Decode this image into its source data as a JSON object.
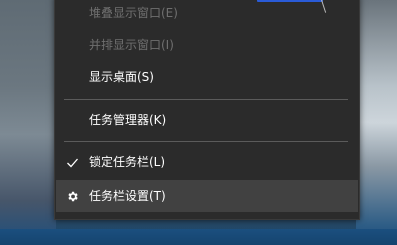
{
  "context_menu": {
    "items": [
      {
        "label": "堆叠显示窗口(E)",
        "enabled": false
      },
      {
        "label": "并排显示窗口(I)",
        "enabled": false
      },
      {
        "label": "显示桌面(S)",
        "enabled": true
      },
      {
        "label": "任务管理器(K)",
        "enabled": true
      },
      {
        "label": "锁定任务栏(L)",
        "enabled": true,
        "checked": true,
        "icon": "checkmark-icon"
      },
      {
        "label": "任务栏设置(T)",
        "enabled": true,
        "highlighted": true,
        "icon": "gear-icon"
      }
    ]
  },
  "colors": {
    "menu_background": "#2b2b2b",
    "menu_hover": "#414141",
    "separator": "#5b5b5b",
    "text": "#ffffff",
    "disabled_text": "#6f6f6f",
    "taskbar": "#1b4f7f"
  }
}
